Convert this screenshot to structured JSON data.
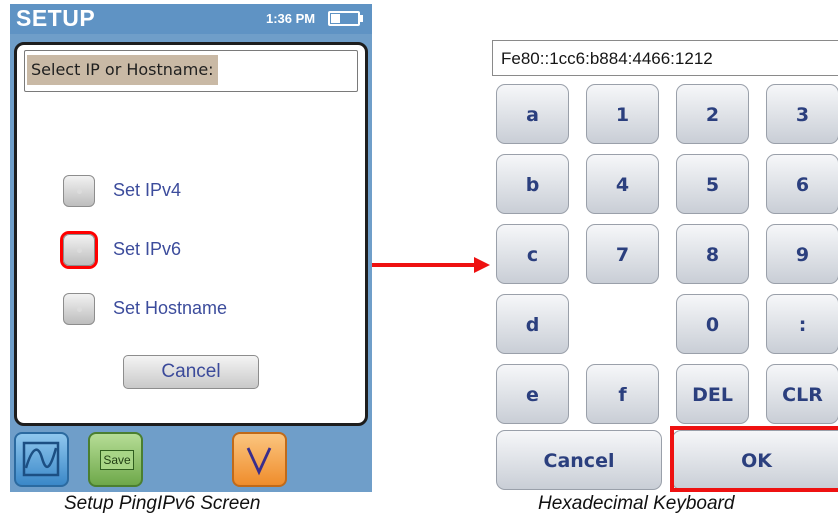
{
  "left_screen": {
    "title": "SETUP",
    "time": "1:36 PM",
    "prompt": "Select IP or Hostname:",
    "options": [
      {
        "label": "Set IPv4"
      },
      {
        "label": "Set IPv6",
        "highlighted": true
      },
      {
        "label": "Set Hostname"
      }
    ],
    "cancel_label": "Cancel",
    "toolbar": {
      "chart_icon": "graph-icon",
      "save_label": "Save",
      "down_label": "V"
    },
    "caption": "Setup PingIPv6 Screen"
  },
  "keyboard": {
    "input_value": "Fe80::1cc6:b884:4466:1212",
    "rows": [
      [
        "a",
        "1",
        "2",
        "3"
      ],
      [
        "b",
        "4",
        "5",
        "6"
      ],
      [
        "c",
        "7",
        "8",
        "9"
      ],
      [
        "d",
        "",
        "0",
        ":"
      ],
      [
        "e",
        "f",
        "DEL",
        "CLR"
      ]
    ],
    "cancel_label": "Cancel",
    "ok_label": "OK",
    "caption": "Hexadecimal Keyboard"
  },
  "colors": {
    "title_bar": "#5f93c4",
    "highlight": "#ee1111",
    "key_text": "#2b3f7e",
    "option_text": "#3c4c9c"
  }
}
